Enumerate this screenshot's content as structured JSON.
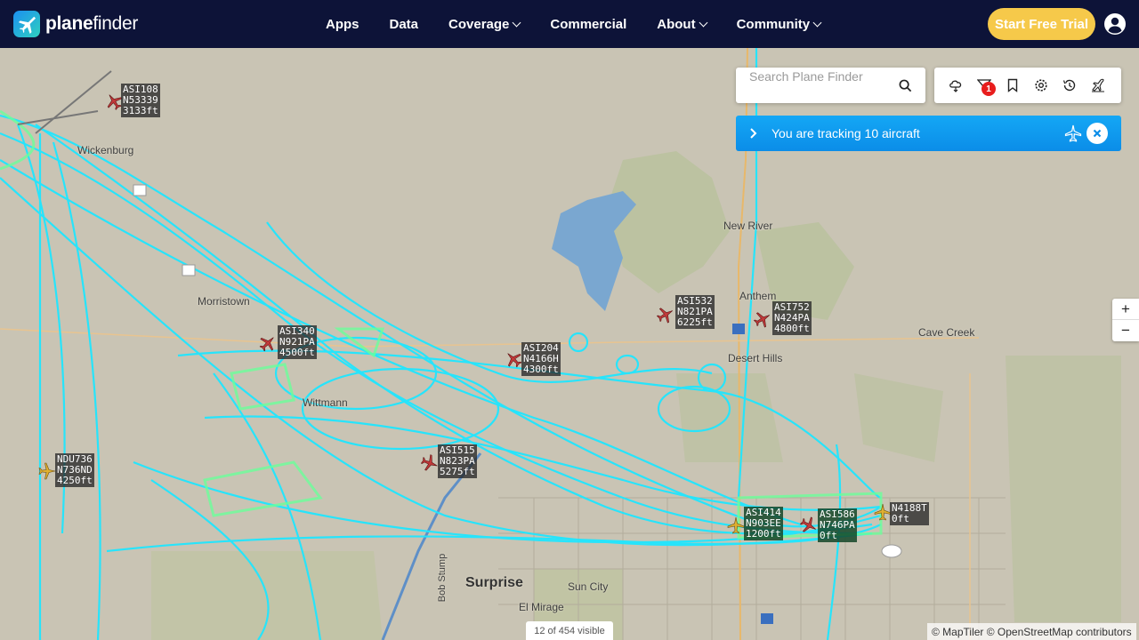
{
  "nav": {
    "logo_bold": "plane",
    "logo_light": "finder",
    "items": [
      {
        "label": "Apps",
        "dropdown": false
      },
      {
        "label": "Data",
        "dropdown": false
      },
      {
        "label": "Coverage",
        "dropdown": true
      },
      {
        "label": "Commercial",
        "dropdown": false
      },
      {
        "label": "About",
        "dropdown": true
      },
      {
        "label": "Community",
        "dropdown": true
      }
    ],
    "cta": "Start Free Trial"
  },
  "search": {
    "placeholder": "Search Plane Finder"
  },
  "toolbar": {
    "icons": [
      "weather-icon",
      "filter-icon",
      "bookmark-icon",
      "settings-icon",
      "history-icon",
      "airport-icon"
    ],
    "filter_badge": "1"
  },
  "tracking": {
    "text": "You are tracking 10 aircraft"
  },
  "zoom": {
    "in": "+",
    "out": "−"
  },
  "status": {
    "visible": "12 of 454 visible",
    "attribution": "© MapTiler © OpenStreetMap contributors"
  },
  "places": [
    {
      "name": "Wickenburg",
      "style": "normal"
    },
    {
      "name": "Morristown",
      "style": "normal"
    },
    {
      "name": "Wittmann",
      "style": "normal"
    },
    {
      "name": "New River",
      "style": "normal"
    },
    {
      "name": "Anthem",
      "style": "normal"
    },
    {
      "name": "Desert Hills",
      "style": "normal"
    },
    {
      "name": "Cave Creek",
      "style": "normal"
    },
    {
      "name": "Surprise",
      "style": "big"
    },
    {
      "name": "Sun City",
      "style": "normal"
    },
    {
      "name": "El Mirage",
      "style": "normal"
    },
    {
      "name": "Bob Stump",
      "style": "normal"
    }
  ],
  "aircraft": [
    {
      "line1": "ASI108",
      "line2": "N53339",
      "line3": "3133ft",
      "color": "#c03a3a"
    },
    {
      "line1": "ASI340",
      "line2": "N921PA",
      "line3": "4500ft",
      "color": "#c03a3a"
    },
    {
      "line1": "ASI204",
      "line2": "N4166H",
      "line3": "4300ft",
      "color": "#c03a3a"
    },
    {
      "line1": "ASI532",
      "line2": "N821PA",
      "line3": "6225ft",
      "color": "#c03a3a"
    },
    {
      "line1": "ASI752",
      "line2": "N424PA",
      "line3": "4800ft",
      "color": "#c03a3a"
    },
    {
      "line1": "NDU736",
      "line2": "N736ND",
      "line3": "4250ft",
      "color": "#e0b030"
    },
    {
      "line1": "ASI515",
      "line2": "N823PA",
      "line3": "5275ft",
      "color": "#c03a3a"
    },
    {
      "line1": "ASI414",
      "line2": "N903EE",
      "line3": "1200ft",
      "color": "#e0b030"
    },
    {
      "line1": "ASI586",
      "line2": "N746PA",
      "line3": "0ft",
      "color": "#c03a3a"
    },
    {
      "line1": "N4188T",
      "line2": "0ft",
      "line3": "",
      "color": "#e0b030"
    }
  ]
}
